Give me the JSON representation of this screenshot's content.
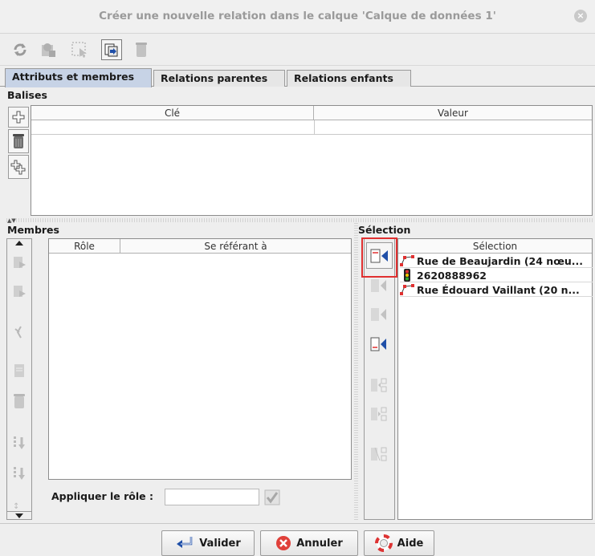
{
  "window": {
    "title": "Créer une nouvelle relation dans le calque 'Calque de données 1'"
  },
  "toolbar": {
    "icons": [
      "refresh-icon",
      "download-members-icon",
      "select-in-layer-icon",
      "apply-icon",
      "delete-icon"
    ]
  },
  "tabs": [
    {
      "label": "Attributs et membres",
      "selected": true
    },
    {
      "label": "Relations parentes",
      "selected": false
    },
    {
      "label": "Relations enfants",
      "selected": false
    }
  ],
  "tags": {
    "section_label": "Balises",
    "columns": [
      "Clé",
      "Valeur"
    ]
  },
  "members": {
    "section_label": "Membres",
    "columns": [
      "Rôle",
      "Se référant à"
    ],
    "apply_role_label": "Appliquer le rôle :",
    "apply_role_value": ""
  },
  "selection": {
    "section_label": "Sélection",
    "column": "Sélection",
    "items": [
      {
        "type": "way",
        "label": "Rue de Beaujardin (24 nœu..."
      },
      {
        "type": "node",
        "label": "2620888962"
      },
      {
        "type": "way",
        "label": "Rue Édouard Vaillant (20 n..."
      }
    ]
  },
  "buttons": {
    "ok": "Valider",
    "cancel": "Annuler",
    "help": "Aide"
  },
  "colors": {
    "highlight": "#e03030",
    "tab_selected": "#c7d3e6",
    "arrow_blue": "#1f4fa8"
  }
}
